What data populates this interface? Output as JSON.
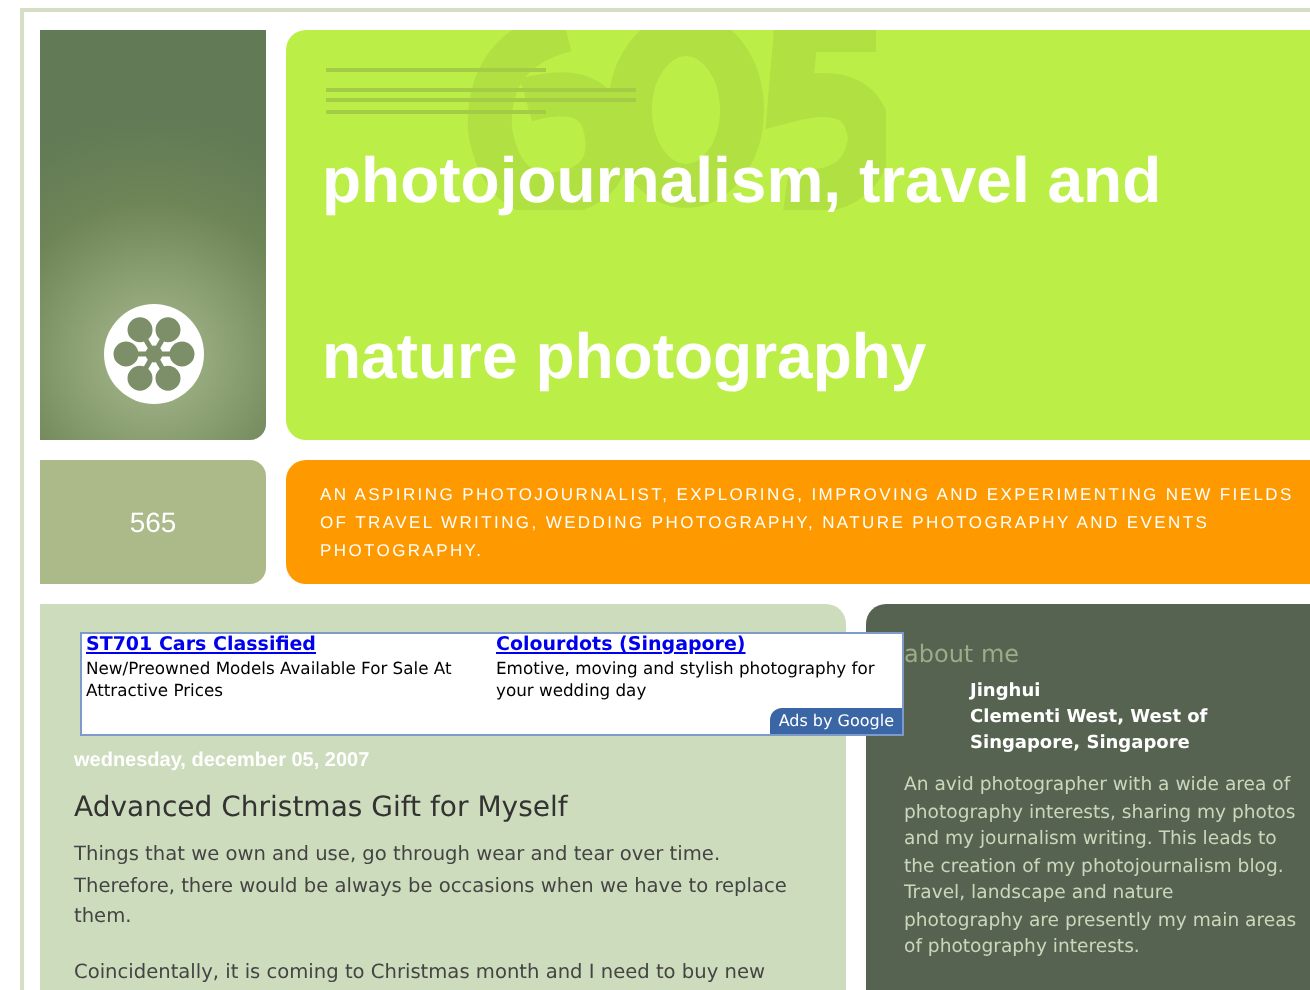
{
  "header": {
    "title_lines": [
      "photojournalism, travel and",
      "nature photography"
    ]
  },
  "badge": {
    "number": "565"
  },
  "description": "AN ASPIRING PHOTOJOURNALIST, EXPLORING, IMPROVING AND EXPERIMENTING NEW FIELDS OF TRAVEL WRITING, WEDDING PHOTOGRAPHY, NATURE PHOTOGRAPHY AND EVENTS PHOTOGRAPHY.",
  "ads": {
    "items": [
      {
        "title": "ST701 Cars Classified",
        "text": "New/Preowned Models Available For Sale At Attractive Prices"
      },
      {
        "title": "Colourdots (Singapore)",
        "text": "Emotive, moving and stylish photography for your wedding day"
      }
    ],
    "label": "Ads by Google"
  },
  "post": {
    "date": "wednesday, december 05, 2007",
    "title": "Advanced Christmas Gift for Myself",
    "paragraphs": [
      "Things that we own and use, go through wear and tear over time. Therefore, there would be always be occasions when we have to replace them.",
      "Coincidentally, it is coming to Christmas month and I need to buy new"
    ]
  },
  "sidebar": {
    "heading": "about me",
    "name": "Jinghui",
    "location": "Clementi West, West of Singapore, Singapore",
    "bio": "An avid photographer with a wide area of photography interests, sharing my photos and my journalism writing. This leads to the creation of my photojournalism blog. Travel, landscape and nature photography are presently my main areas of photography interests."
  }
}
